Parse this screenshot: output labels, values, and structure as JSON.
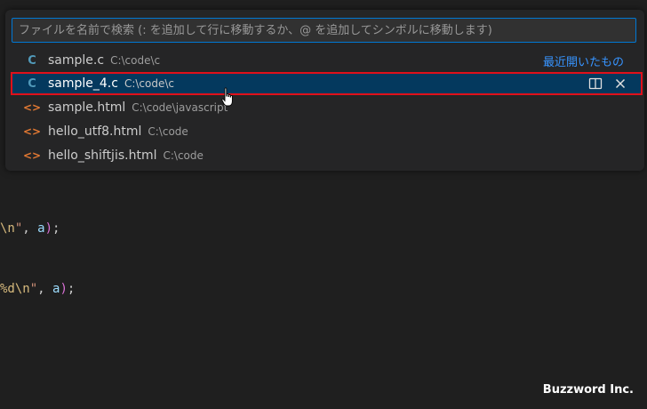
{
  "search": {
    "placeholder": "ファイルを名前で検索 (: を追加して行に移動するか、@ を追加してシンボルに移動します)"
  },
  "recent_label": "最近開いたもの",
  "files": [
    {
      "name": "sample.c",
      "path": "C:\\code\\c",
      "type": "c",
      "icon": "C"
    },
    {
      "name": "sample_4.c",
      "path": "C:\\code\\c",
      "type": "c",
      "icon": "C",
      "selected": true
    },
    {
      "name": "sample.html",
      "path": "C:\\code\\javascript",
      "type": "html",
      "icon": "<>"
    },
    {
      "name": "hello_utf8.html",
      "path": "C:\\code",
      "type": "html",
      "icon": "<>"
    },
    {
      "name": "hello_shiftjis.html",
      "path": "C:\\code",
      "type": "html",
      "icon": "<>"
    }
  ],
  "code": {
    "line1": {
      "esc": "\\n",
      "str": "\"",
      "sep": ", ",
      "var": "a",
      "paren": ")",
      "end": ";"
    },
    "line2": {
      "esc": "%d\\n",
      "str": "\"",
      "sep": ", ",
      "var": "a",
      "paren": ")",
      "end": ";"
    }
  },
  "icons": {
    "split": "split-editor-icon",
    "close": "close-icon"
  },
  "colors": {
    "accent": "#0078d4",
    "selected_bg": "#04395e",
    "highlight_border": "#e0101a"
  },
  "watermark": "Buzzword Inc."
}
